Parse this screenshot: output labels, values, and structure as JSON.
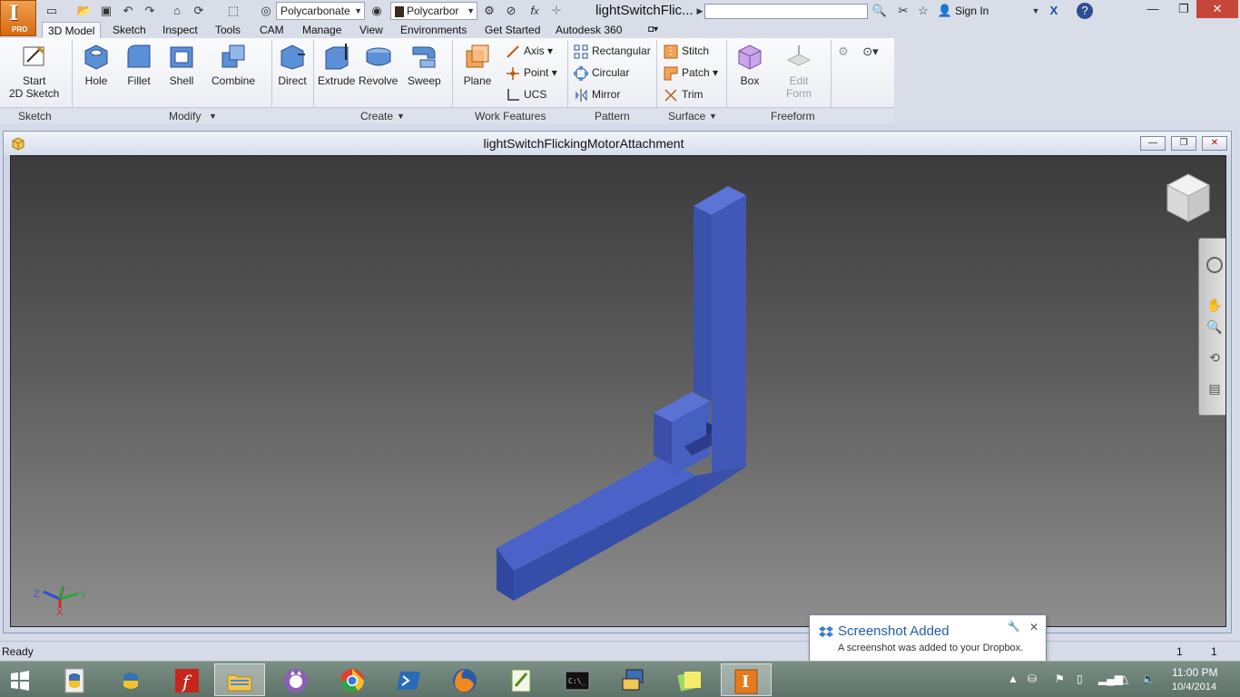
{
  "app": {
    "logo_letter": "I",
    "logo_badge": "PRO",
    "document_title": "lightSwitchFlic...",
    "material_value": "Polycarbonate",
    "appearance_value": "Polycarbor",
    "sign_in": "Sign In"
  },
  "tabs": [
    {
      "label": "3D Model"
    },
    {
      "label": "Sketch"
    },
    {
      "label": "Inspect"
    },
    {
      "label": "Tools"
    },
    {
      "label": "CAM"
    },
    {
      "label": "Manage"
    },
    {
      "label": "View"
    },
    {
      "label": "Environments"
    },
    {
      "label": "Get Started"
    },
    {
      "label": "Autodesk 360"
    }
  ],
  "ribbon": {
    "sketch": {
      "start_line1": "Start",
      "start_line2": "2D Sketch",
      "panel": "Sketch"
    },
    "modify": {
      "hole": "Hole",
      "fillet": "Fillet",
      "shell": "Shell",
      "combine": "Combine",
      "direct": "Direct",
      "panel": "Modify"
    },
    "create": {
      "extrude": "Extrude",
      "revolve": "Revolve",
      "sweep": "Sweep",
      "panel": "Create"
    },
    "work_features": {
      "plane": "Plane",
      "axis": "Axis",
      "point": "Point",
      "ucs": "UCS",
      "panel": "Work Features"
    },
    "pattern": {
      "rectangular": "Rectangular",
      "circular": "Circular",
      "mirror": "Mirror",
      "panel": "Pattern"
    },
    "surface": {
      "stitch": "Stitch",
      "patch": "Patch",
      "trim": "Trim",
      "panel": "Surface"
    },
    "freeform": {
      "box": "Box",
      "edit_line1": "Edit",
      "edit_line2": "Form",
      "panel": "Freeform"
    }
  },
  "document": {
    "window_title": "lightSwitchFlickingMotorAttachment",
    "model_color": "#3f55b4",
    "triad": {
      "x": "X",
      "y": "Y",
      "z": "Z"
    }
  },
  "status": {
    "text": "Ready",
    "count1": "1",
    "count2": "1"
  },
  "toast": {
    "title": "Screenshot Added",
    "message": "A screenshot was added to your Dropbox."
  },
  "taskbar": {
    "time": "11:00 PM",
    "date": "10/4/2014"
  }
}
